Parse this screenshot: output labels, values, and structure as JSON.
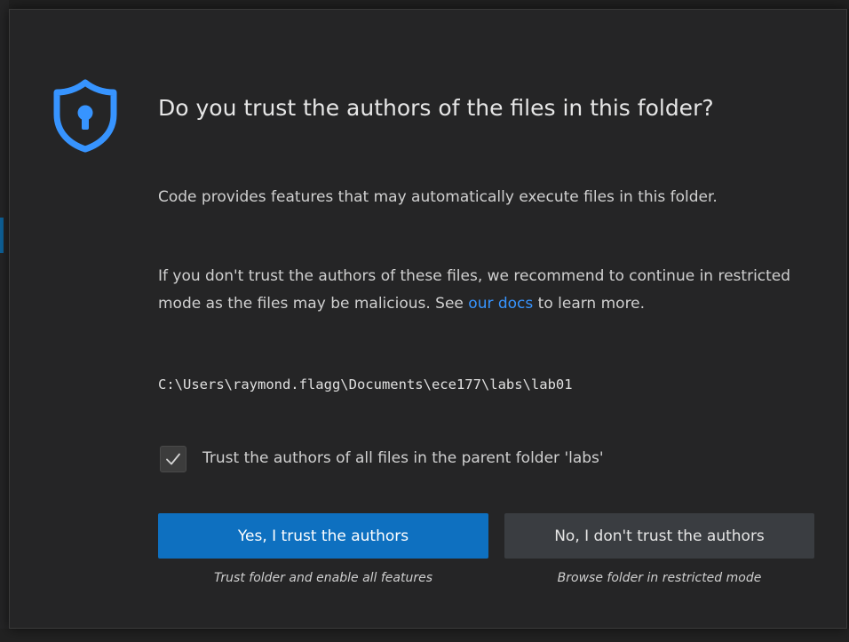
{
  "dialog": {
    "title": "Do you trust the authors of the files in this folder?",
    "paragraph1": "Code provides features that may automatically execute files in this folder.",
    "paragraph2_before_link": "If you don't trust the authors of these files, we recommend to continue in restricted mode as the files may be malicious. See ",
    "paragraph2_link": "our docs",
    "paragraph2_after_link": " to learn more.",
    "folder_path": "C:\\Users\\raymond.flagg\\Documents\\ece177\\labs\\lab01",
    "checkbox": {
      "label": "Trust the authors of all files in the parent folder 'labs'",
      "checked": true
    },
    "buttons": {
      "trust": {
        "label": "Yes, I trust the authors",
        "description": "Trust folder and enable all features"
      },
      "dont_trust": {
        "label": "No, I don't trust the authors",
        "description": "Browse folder in restricted mode"
      }
    },
    "icons": {
      "header": "shield-lock-icon",
      "checkbox_mark": "checkmark-icon"
    },
    "colors": {
      "accent": "#0e70c0",
      "link": "#3794ff",
      "shield": "#3794ff"
    }
  }
}
